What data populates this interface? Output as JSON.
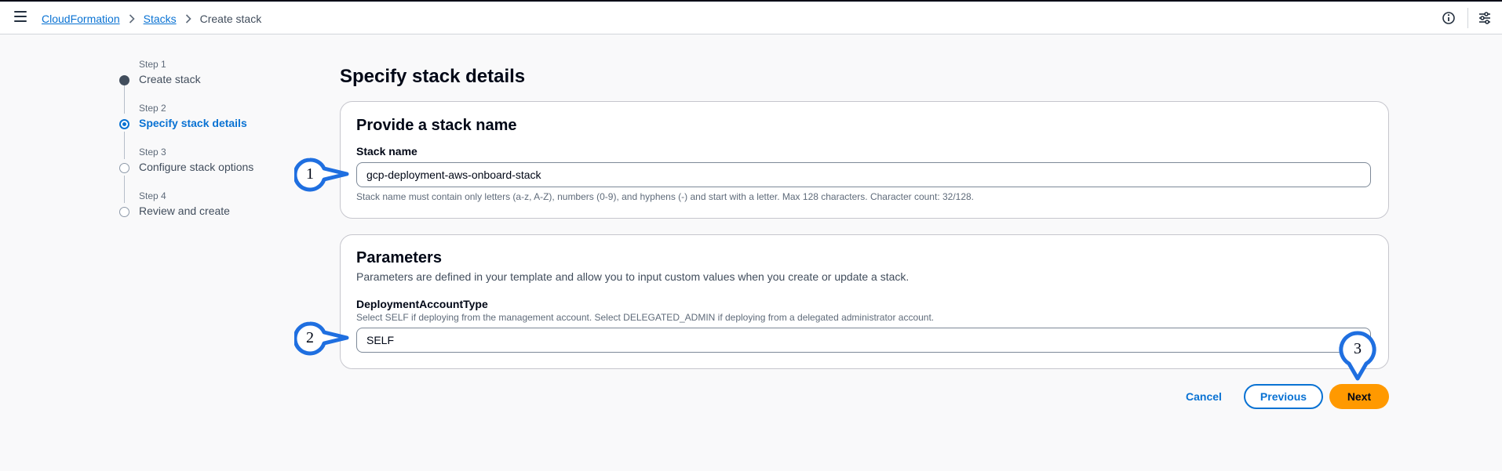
{
  "topbar": {
    "menu_icon": "hamburger-menu-icon",
    "breadcrumbs": [
      {
        "label": "CloudFormation"
      },
      {
        "label": "Stacks"
      },
      {
        "label": "Create stack"
      }
    ],
    "right_icons": [
      "info-icon",
      "preferences-icon"
    ]
  },
  "steps": [
    {
      "number": "Step 1",
      "title": "Create stack",
      "state": "done"
    },
    {
      "number": "Step 2",
      "title": "Specify stack details",
      "state": "active"
    },
    {
      "number": "Step 3",
      "title": "Configure stack options",
      "state": "pending"
    },
    {
      "number": "Step 4",
      "title": "Review and create",
      "state": "pending"
    }
  ],
  "page": {
    "title": "Specify stack details"
  },
  "stack_name_card": {
    "heading": "Provide a stack name",
    "field_label": "Stack name",
    "value": "gcp-deployment-aws-onboard-stack",
    "constraint": "Stack name must contain only letters (a-z, A-Z), numbers (0-9), and hyphens (-) and start with a letter. Max 128 characters. Character count: 32/128."
  },
  "parameters_card": {
    "heading": "Parameters",
    "description": "Parameters are defined in your template and allow you to input custom values when you create or update a stack.",
    "field_label": "DeploymentAccountType",
    "field_description": "Select SELF if deploying from the management account. Select DELEGATED_ADMIN if deploying from a delegated administrator account.",
    "value": "SELF"
  },
  "actions": {
    "cancel": "Cancel",
    "previous": "Previous",
    "next": "Next"
  },
  "callouts": [
    {
      "label": "1"
    },
    {
      "label": "2"
    },
    {
      "label": "3"
    }
  ],
  "colors": {
    "accent": "#0972d3",
    "primary_button": "#ff9900",
    "callout_ring": "#1f6fe0"
  }
}
